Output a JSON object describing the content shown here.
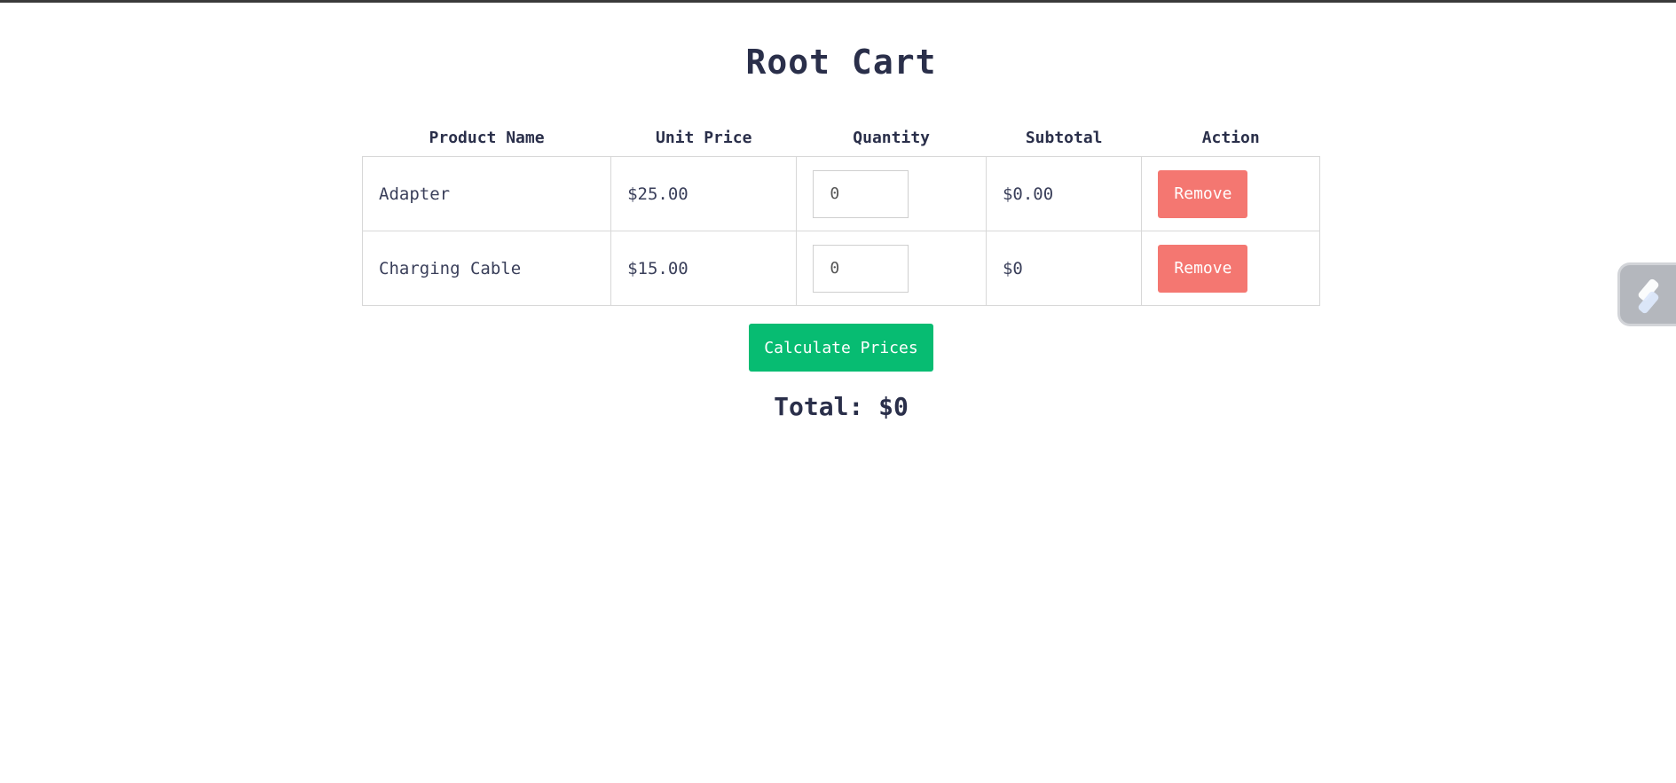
{
  "page": {
    "title": "Root Cart"
  },
  "table": {
    "headers": [
      "Product Name",
      "Unit Price",
      "Quantity",
      "Subtotal",
      "Action"
    ],
    "rows": [
      {
        "name": "Adapter",
        "unit_price": "$25.00",
        "quantity": "0",
        "subtotal": "$0.00",
        "action_label": "Remove"
      },
      {
        "name": "Charging Cable",
        "unit_price": "$15.00",
        "quantity": "0",
        "subtotal": "$0",
        "action_label": "Remove"
      }
    ]
  },
  "actions": {
    "calculate_label": "Calculate Prices"
  },
  "summary": {
    "total_text": "Total: $0"
  },
  "widgets": {
    "side_widget_icon": "extension-logo-icon"
  },
  "colors": {
    "remove": "#f47771",
    "calculate": "#07bc72",
    "text": "#2a2f4a"
  }
}
